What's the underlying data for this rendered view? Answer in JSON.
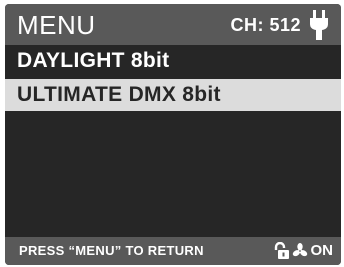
{
  "header": {
    "title": "MENU",
    "channel": "CH: 512",
    "power_icon": "plug-icon"
  },
  "menu": {
    "items": [
      {
        "label": "DAYLIGHT 8bit",
        "selected": false
      },
      {
        "label": "ULTIMATE DMX 8bit",
        "selected": true
      }
    ]
  },
  "footer": {
    "hint": "PRESS “MENU” TO RETURN",
    "lock_icon": "unlock-icon",
    "fan_icon": "fan-icon",
    "fan_status": "ON"
  },
  "colors": {
    "screen_bg": "#262626",
    "bar_bg": "#595959",
    "highlight_bg": "#dcdcdc",
    "text": "#ffffff"
  }
}
